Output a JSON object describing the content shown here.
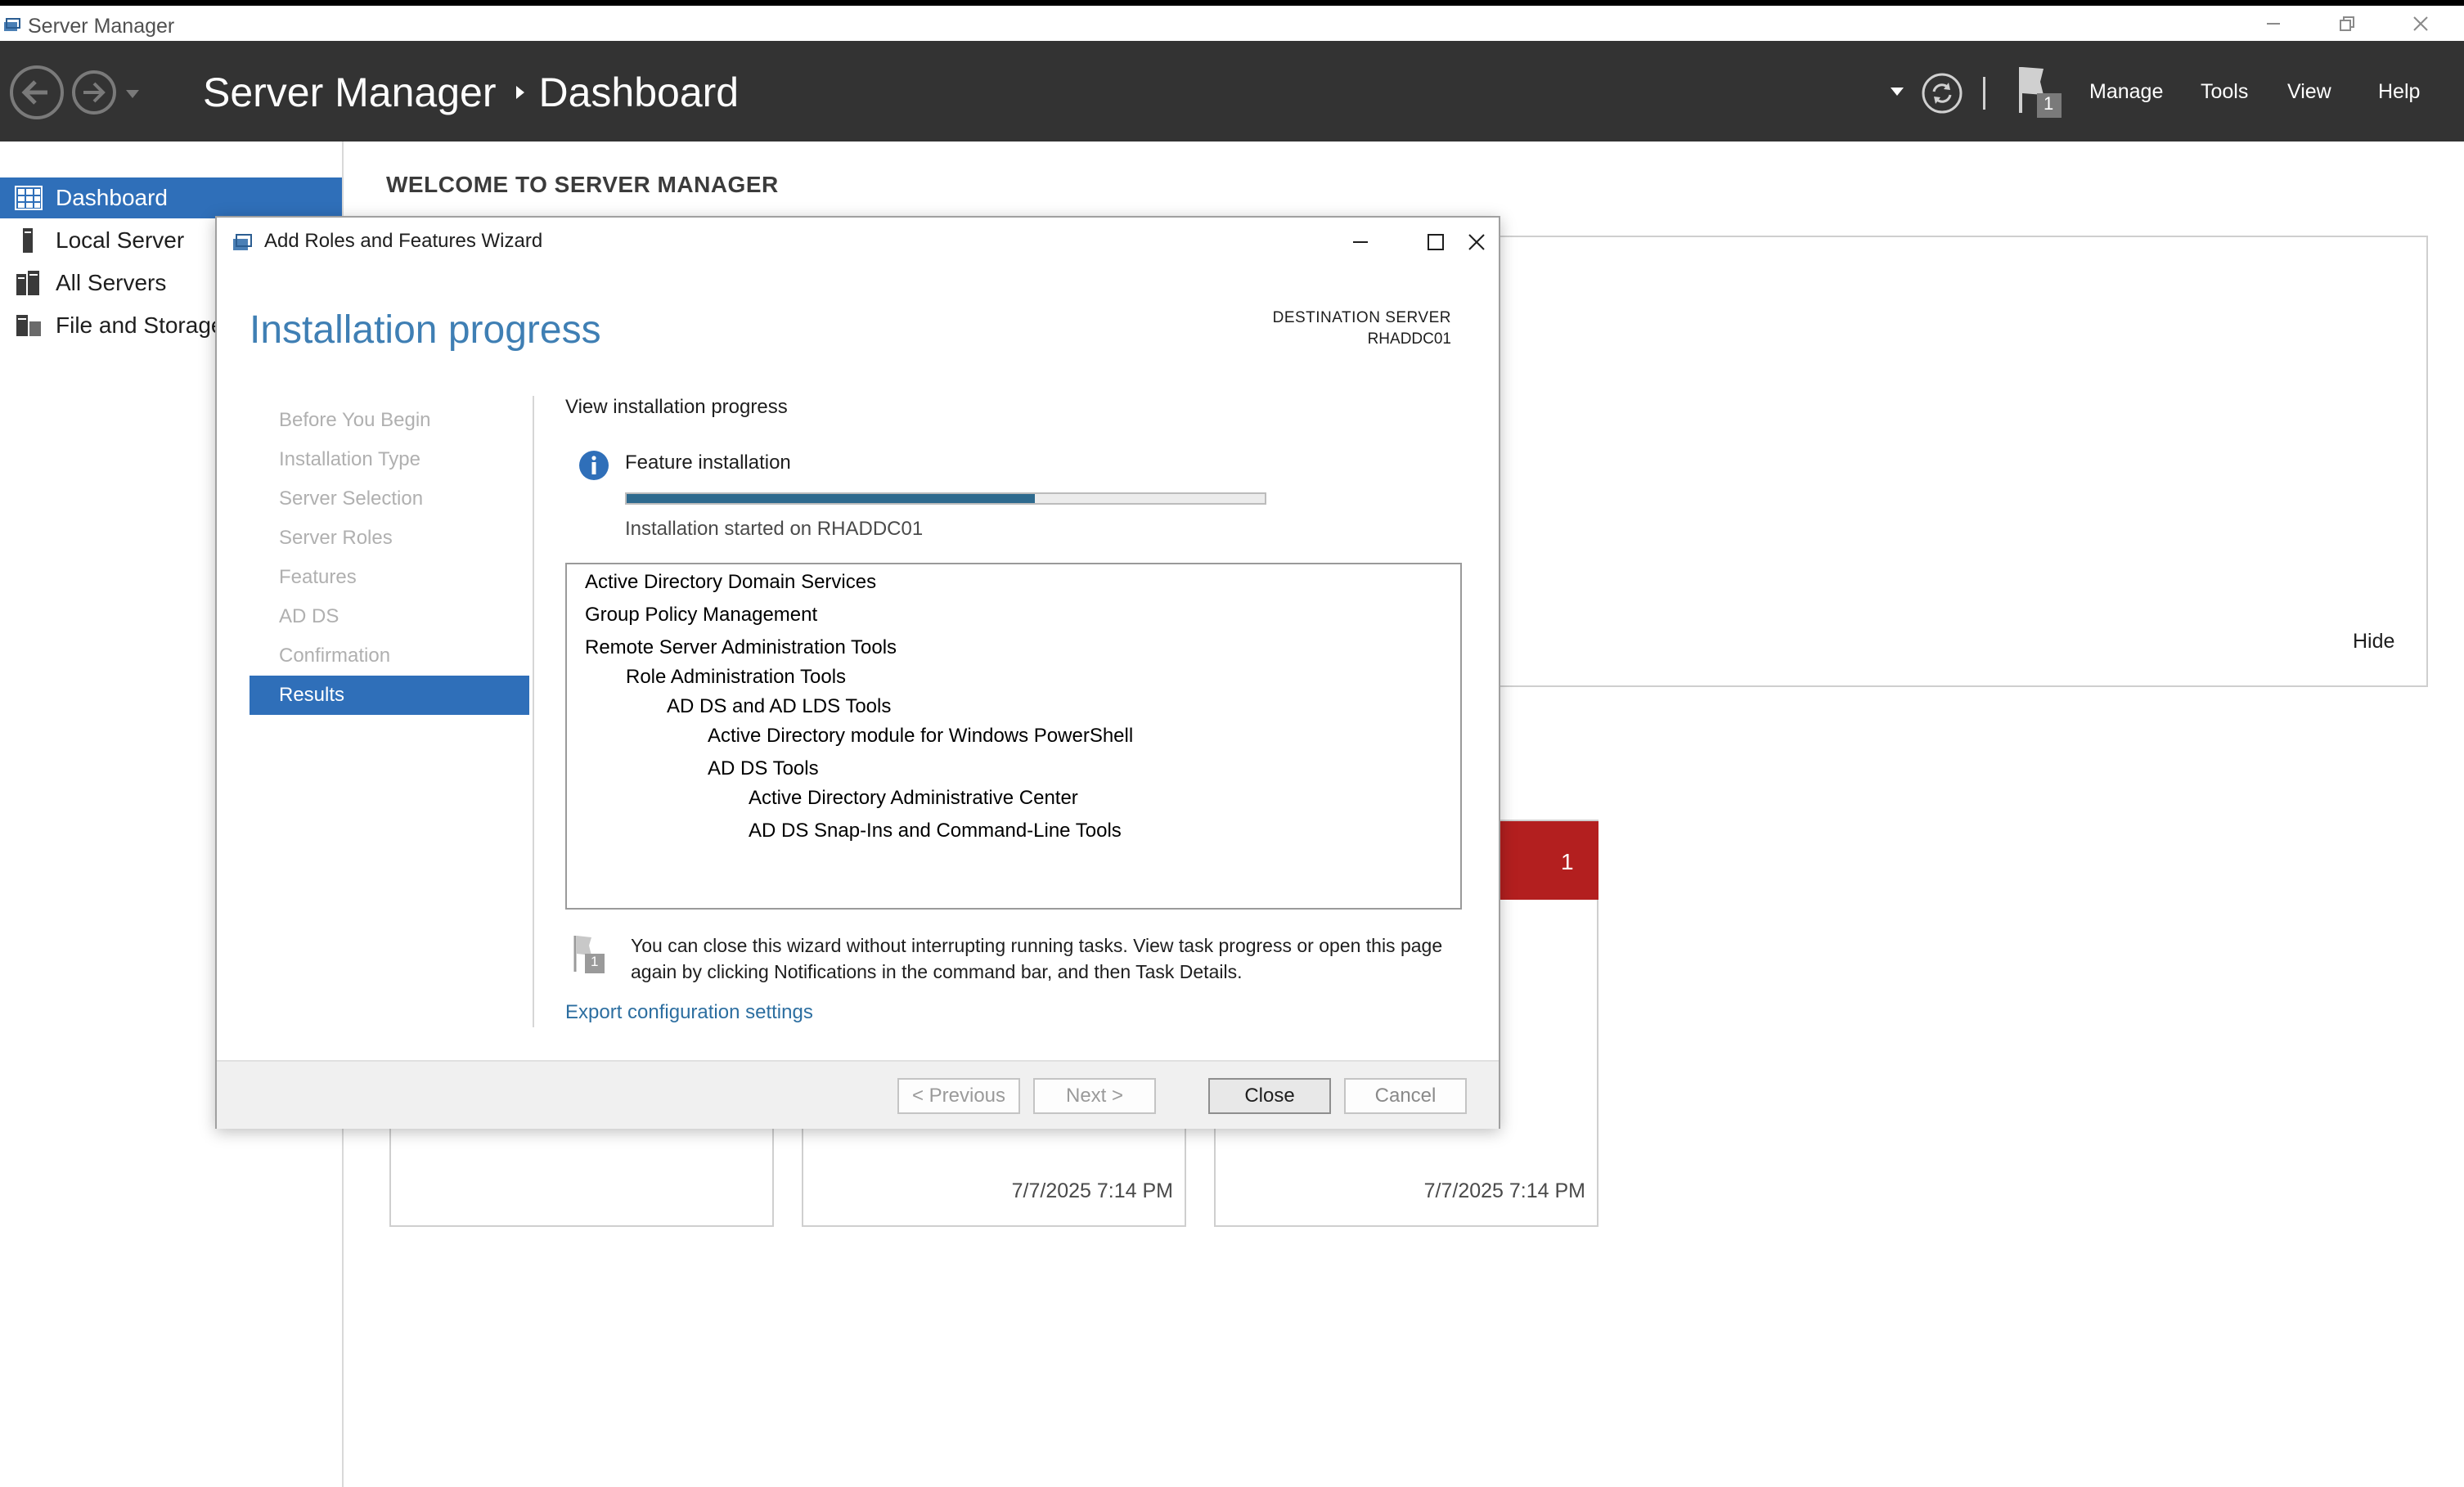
{
  "window": {
    "title": "Server Manager"
  },
  "header": {
    "breadcrumb_root": "Server Manager",
    "breadcrumb_current": "Dashboard",
    "notification_count": "1",
    "menu": [
      "Manage",
      "Tools",
      "View",
      "Help"
    ]
  },
  "sidebar": {
    "items": [
      {
        "label": "Dashboard",
        "icon": "dashboard-icon",
        "active": true
      },
      {
        "label": "Local Server",
        "icon": "server-icon",
        "active": false
      },
      {
        "label": "All Servers",
        "icon": "servers-icon",
        "active": false
      },
      {
        "label": "File and Storage",
        "icon": "storage-icon",
        "active": false
      }
    ]
  },
  "main": {
    "welcome_title": "WELCOME TO SERVER MANAGER",
    "hide_label": "Hide",
    "tiles": [
      {
        "time": ""
      },
      {
        "time": "7/7/2025 7:14 PM"
      },
      {
        "time": "7/7/2025 7:14 PM",
        "alert_count": "1"
      }
    ]
  },
  "wizard": {
    "title": "Add Roles and Features Wizard",
    "heading": "Installation progress",
    "destination_label": "DESTINATION SERVER",
    "destination_server": "RHADDC01",
    "steps": [
      {
        "label": "Before You Begin",
        "active": false
      },
      {
        "label": "Installation Type",
        "active": false
      },
      {
        "label": "Server Selection",
        "active": false
      },
      {
        "label": "Server Roles",
        "active": false
      },
      {
        "label": "Features",
        "active": false
      },
      {
        "label": "AD DS",
        "active": false
      },
      {
        "label": "Confirmation",
        "active": false
      },
      {
        "label": "Results",
        "active": true
      }
    ],
    "view_progress": "View installation progress",
    "feature_label": "Feature installation",
    "progress_fraction": 0.64,
    "started_text": "Installation started on RHADDC01",
    "features": [
      {
        "label": "Active Directory Domain Services",
        "level": 0
      },
      {
        "label": "Group Policy Management",
        "level": 0
      },
      {
        "label": "Remote Server Administration Tools",
        "level": 0
      },
      {
        "label": "Role Administration Tools",
        "level": 1
      },
      {
        "label": "AD DS and AD LDS Tools",
        "level": 2
      },
      {
        "label": "Active Directory module for Windows PowerShell",
        "level": 3
      },
      {
        "label": "AD DS Tools",
        "level": 3
      },
      {
        "label": "Active Directory Administrative Center",
        "level": 4
      },
      {
        "label": "AD DS Snap-Ins and Command-Line Tools",
        "level": 4
      }
    ],
    "note": "You can close this wizard without interrupting running tasks. View task progress or open this page again by clicking Notifications in the command bar, and then Task Details.",
    "note_flag_count": "1",
    "export_link": "Export configuration settings",
    "buttons": {
      "previous": "< Previous",
      "next": "Next >",
      "close": "Close",
      "cancel": "Cancel"
    }
  },
  "colors": {
    "accent": "#2f6fb9",
    "command_bar": "#333333",
    "heading": "#3f7fb4",
    "progress": "#2e6a8e",
    "alert": "#b31f1f"
  }
}
